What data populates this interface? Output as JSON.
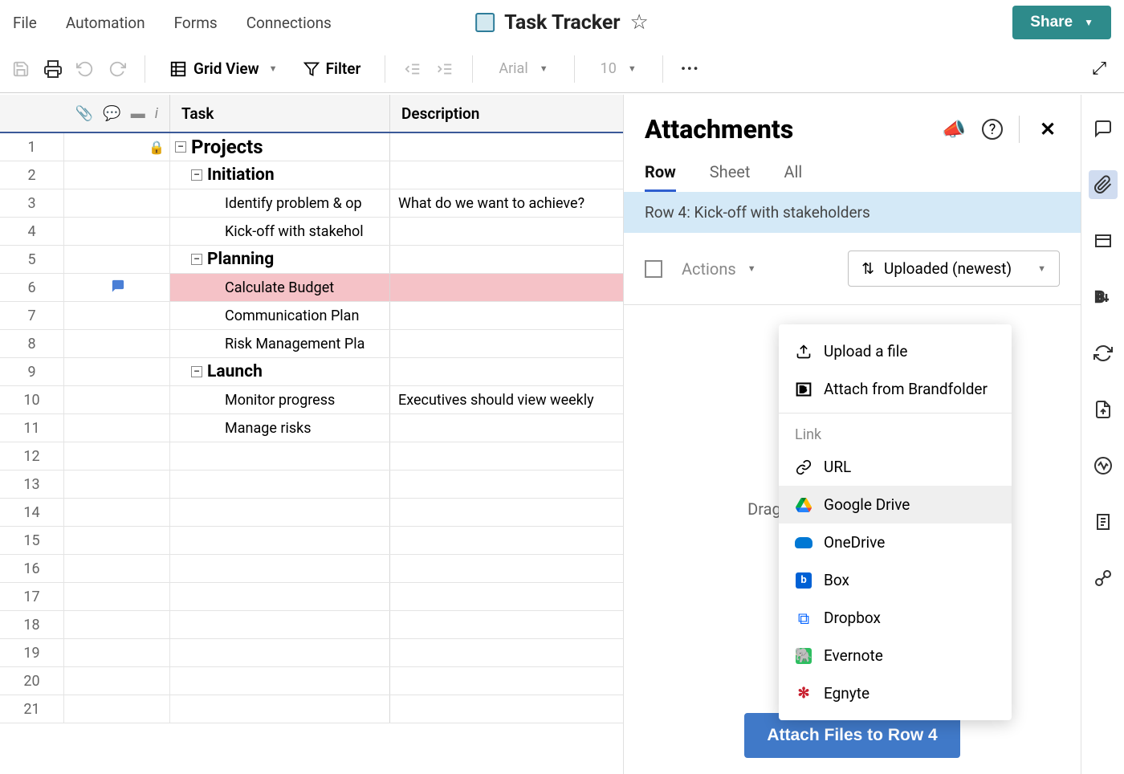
{
  "menu": {
    "file": "File",
    "automation": "Automation",
    "forms": "Forms",
    "connections": "Connections"
  },
  "doc": {
    "title": "Task Tracker"
  },
  "share": {
    "label": "Share"
  },
  "toolbar": {
    "grid_view": "Grid View",
    "filter": "Filter",
    "font": "Arial",
    "size": "10"
  },
  "columns": {
    "task": "Task",
    "description": "Description"
  },
  "rows": [
    {
      "n": 1,
      "level": "h1",
      "task": "Projects",
      "desc": "",
      "lock": true
    },
    {
      "n": 2,
      "level": "h2",
      "task": "Initiation",
      "desc": ""
    },
    {
      "n": 3,
      "level": "leaf",
      "task": "Identify problem & op",
      "desc": "What do we want to achieve?"
    },
    {
      "n": 4,
      "level": "leaf",
      "task": "Kick-off with stakehol",
      "desc": ""
    },
    {
      "n": 5,
      "level": "h2",
      "task": "Planning",
      "desc": ""
    },
    {
      "n": 6,
      "level": "leaf",
      "task": "Calculate Budget",
      "desc": "",
      "highlight": true,
      "comment": true
    },
    {
      "n": 7,
      "level": "leaf",
      "task": "Communication Plan",
      "desc": ""
    },
    {
      "n": 8,
      "level": "leaf",
      "task": "Risk Management Pla",
      "desc": ""
    },
    {
      "n": 9,
      "level": "h2",
      "task": "Launch",
      "desc": ""
    },
    {
      "n": 10,
      "level": "leaf",
      "task": "Monitor progress",
      "desc": "Executives should view weekly"
    },
    {
      "n": 11,
      "level": "leaf",
      "task": "Manage risks",
      "desc": ""
    },
    {
      "n": 12,
      "level": "empty"
    },
    {
      "n": 13,
      "level": "empty"
    },
    {
      "n": 14,
      "level": "empty"
    },
    {
      "n": 15,
      "level": "empty"
    },
    {
      "n": 16,
      "level": "empty"
    },
    {
      "n": 17,
      "level": "empty"
    },
    {
      "n": 18,
      "level": "empty"
    },
    {
      "n": 19,
      "level": "empty"
    },
    {
      "n": 20,
      "level": "empty"
    },
    {
      "n": 21,
      "level": "empty"
    }
  ],
  "panel": {
    "title": "Attachments",
    "tabs": {
      "row": "Row",
      "sheet": "Sheet",
      "all": "All"
    },
    "banner": "Row 4: Kick-off with stakeholders",
    "actions": "Actions",
    "sort": "Uploaded (newest)",
    "dropzone": "Drag and drop files to upload.",
    "button": "Attach Files to Row 4"
  },
  "dropdown": {
    "upload": "Upload a file",
    "brandfolder": "Attach from Brandfolder",
    "link_head": "Link",
    "url": "URL",
    "gdrive": "Google Drive",
    "onedrive": "OneDrive",
    "box": "Box",
    "dropbox": "Dropbox",
    "evernote": "Evernote",
    "egnyte": "Egnyte"
  }
}
